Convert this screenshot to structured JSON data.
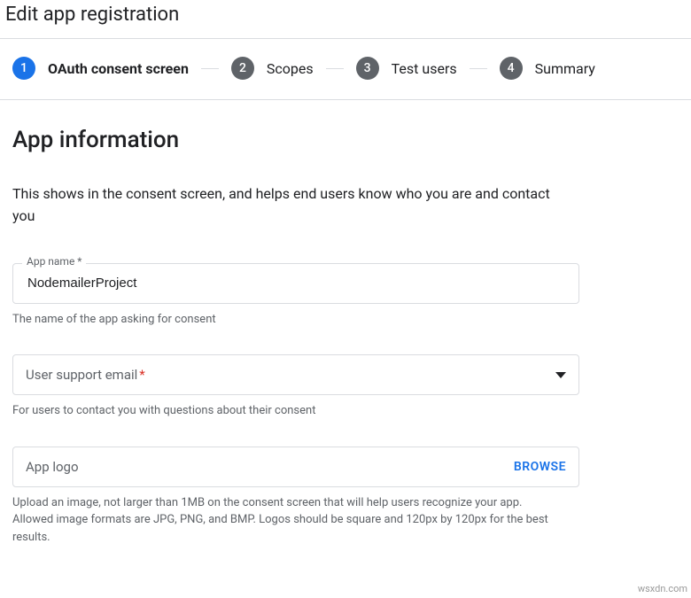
{
  "page_title": "Edit app registration",
  "stepper": {
    "steps": [
      {
        "num": "1",
        "label": "OAuth consent screen",
        "active": true
      },
      {
        "num": "2",
        "label": "Scopes",
        "active": false
      },
      {
        "num": "3",
        "label": "Test users",
        "active": false
      },
      {
        "num": "4",
        "label": "Summary",
        "active": false
      }
    ]
  },
  "section": {
    "heading": "App information",
    "description": "This shows in the consent screen, and helps end users know who you are and contact you"
  },
  "fields": {
    "app_name": {
      "label": "App name *",
      "value": "NodemailerProject",
      "helper": "The name of the app asking for consent"
    },
    "support_email": {
      "label": "User support email",
      "required_marker": "*",
      "helper": "For users to contact you with questions about their consent"
    },
    "app_logo": {
      "label": "App logo",
      "browse": "BROWSE",
      "helper": "Upload an image, not larger than 1MB on the consent screen that will help users recognize your app. Allowed image formats are JPG, PNG, and BMP. Logos should be square and 120px by 120px for the best results."
    }
  },
  "watermark": "wsxdn.com"
}
